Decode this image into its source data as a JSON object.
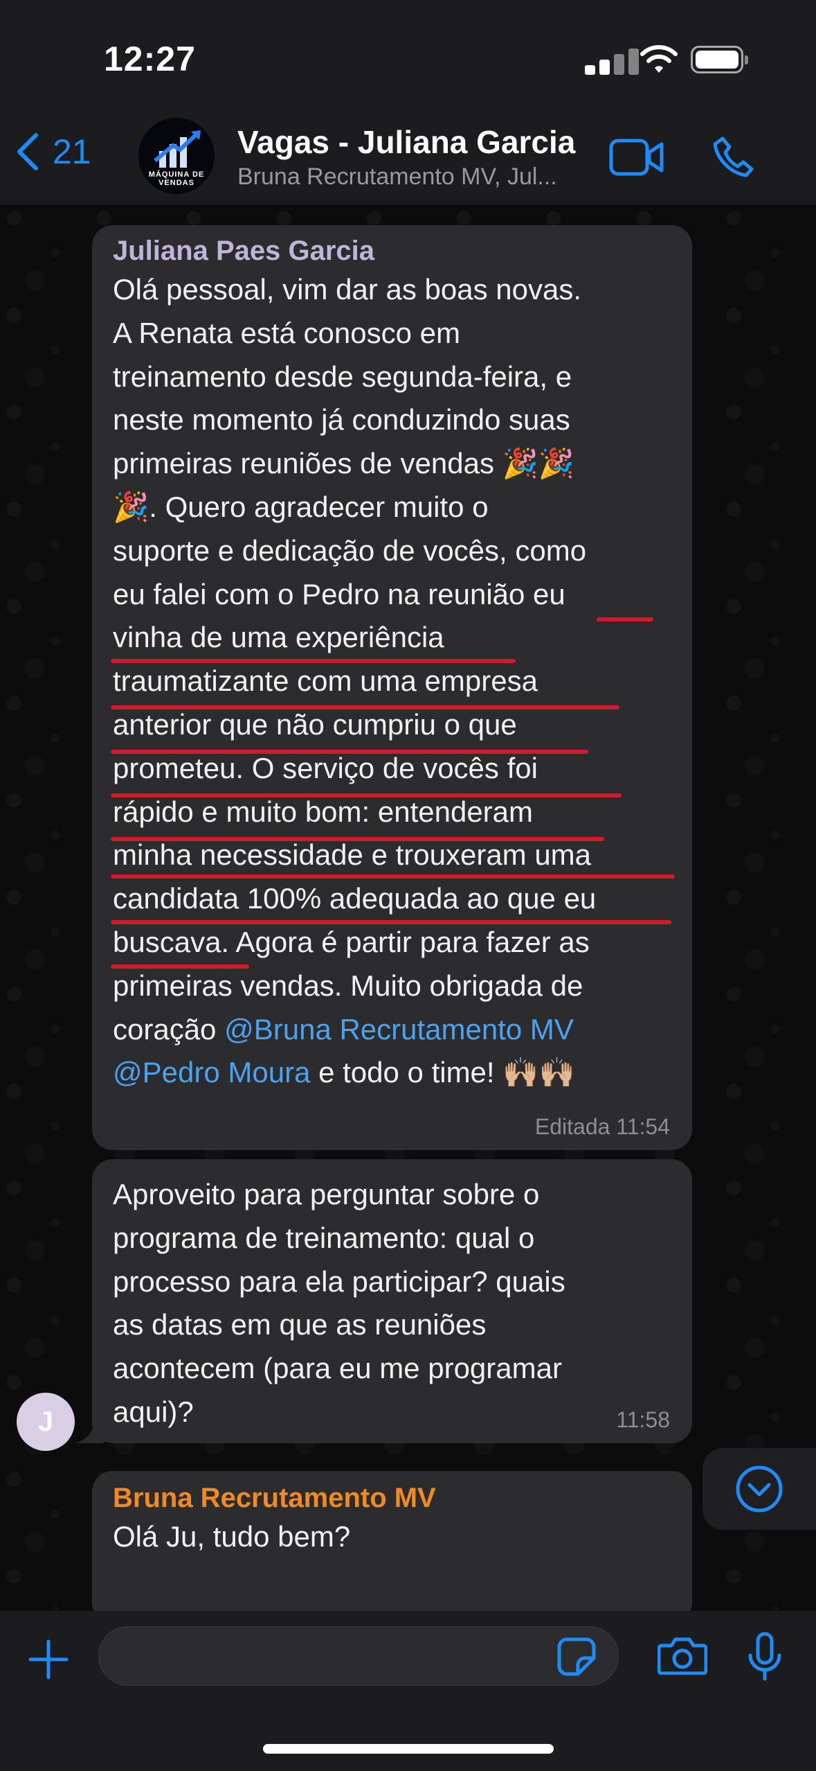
{
  "status_bar": {
    "time": "12:27"
  },
  "header": {
    "back_count": "21",
    "avatar_text": "MÁQUINA DE VENDAS",
    "title": "Vagas - Juliana Garcia",
    "subtitle": "Bruna Recrutamento MV, Jul..."
  },
  "messages": [
    {
      "sender": "Juliana Paes Garcia",
      "lines": [
        "Olá pessoal, vim dar as boas novas.",
        "A Renata está conosco em",
        "treinamento desde segunda-feira, e",
        "neste momento já conduzindo suas",
        "primeiras reuniões de vendas 🎉🎉",
        "🎉. Quero agradecer muito o",
        "suporte e dedicação de vocês, como",
        "eu falei com o Pedro na reunião eu",
        "vinha de uma experiência",
        "traumatizante com uma empresa",
        "anterior que não cumpriu o que",
        "prometeu. O serviço de vocês foi",
        "rápido e muito bom: entenderam",
        "minha necessidade e trouxeram uma",
        "candidata 100% adequada ao que eu",
        "buscava. Agora é partir para fazer as",
        "primeiras vendas. Muito obrigada de"
      ],
      "line18_prefix": "coração ",
      "mention1": "@Bruna Recrutamento MV",
      "mention2": "@Pedro Moura",
      "line19_suffix": "  e todo o time! 🙌🏼🙌🏼",
      "meta": "Editada 11:54"
    },
    {
      "lines": [
        "Aproveito para perguntar sobre o",
        "programa de treinamento: qual o",
        "processo para ela participar? quais",
        "as datas em que as reuniões",
        "acontecem (para eu me programar",
        "aqui)?"
      ],
      "meta": "11:58",
      "avatar_initial": "J"
    },
    {
      "sender": "Bruna Recrutamento MV",
      "lines": [
        "Olá Ju, tudo bem?"
      ]
    }
  ],
  "input": {
    "placeholder": ""
  },
  "colors": {
    "accent": "#1d8cf8",
    "mention": "#4aa3f0",
    "sender_orange": "#f08a24",
    "underline_red": "#d11a2a"
  }
}
